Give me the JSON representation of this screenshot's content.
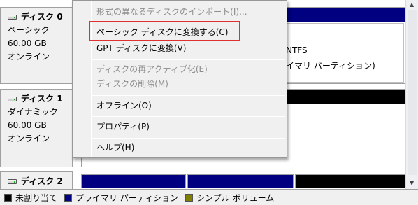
{
  "disks": [
    {
      "name": "ディスク 0",
      "type": "ベーシック",
      "size": "60.00 GB",
      "status": "オンライン"
    },
    {
      "name": "ディスク 1",
      "type": "ダイナミック",
      "size": "60.00 GB",
      "status": "オンライン"
    },
    {
      "name": "ディスク 2"
    }
  ],
  "partition": {
    "filesystem": "NTFS",
    "status": "イマリ パーティション)"
  },
  "context_menu": {
    "items": [
      {
        "label": "形式の異なるディスクのインポート(I)...",
        "enabled": false
      },
      {
        "label": "ベーシック ディスクに変換する(C)",
        "enabled": true,
        "highlighted": true
      },
      {
        "label": "GPT ディスクに変換(V)",
        "enabled": true
      },
      {
        "label": "ディスクの再アクティブ化(E)",
        "enabled": false
      },
      {
        "label": "ディスクの削除(M)",
        "enabled": false
      },
      {
        "label": "オフライン(O)",
        "enabled": true
      },
      {
        "label": "プロパティ(P)",
        "enabled": true
      },
      {
        "label": "ヘルプ(H)",
        "enabled": true
      }
    ]
  },
  "legend": [
    {
      "label": "未割り当て",
      "color": "#000000"
    },
    {
      "label": "プライマリ パーティション",
      "color": "#000080"
    },
    {
      "label": "シンプル ボリューム",
      "color": "#808000"
    }
  ],
  "colors": {
    "highlight_box": "#e03030",
    "primary": "#000080",
    "unallocated": "#000000",
    "simple": "#808000"
  }
}
